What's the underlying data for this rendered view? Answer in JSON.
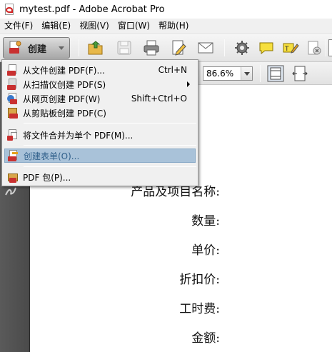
{
  "window": {
    "title": "mytest.pdf - Adobe Acrobat Pro"
  },
  "menubar": {
    "items": [
      {
        "label": "文件(F)"
      },
      {
        "label": "编辑(E)"
      },
      {
        "label": "视图(V)"
      },
      {
        "label": "窗口(W)"
      },
      {
        "label": "帮助(H)"
      }
    ]
  },
  "toolbar": {
    "create_label": "创建",
    "icons": [
      "open-folder-icon",
      "save-icon",
      "print-icon",
      "edit-document-icon",
      "email-icon",
      "settings-gear-icon",
      "comment-bubble-icon",
      "highlight-pen-icon",
      "attach-icon"
    ]
  },
  "toolbar2": {
    "zoom_value": "86.6%"
  },
  "dropdown": {
    "items": [
      {
        "label": "从文件创建 PDF(F)...",
        "shortcut": "Ctrl+N",
        "icon": "pdf-from-file-icon"
      },
      {
        "label": "从扫描仪创建 PDF(S)",
        "shortcut": "",
        "icon": "pdf-from-scanner-icon",
        "submenu": true
      },
      {
        "label": "从网页创建 PDF(W)",
        "shortcut": "Shift+Ctrl+O",
        "icon": "pdf-from-web-icon"
      },
      {
        "label": "从剪贴板创建 PDF(C)",
        "shortcut": "",
        "icon": "pdf-from-clipboard-icon"
      },
      {
        "label": "将文件合并为单个 PDF(M)...",
        "shortcut": "",
        "icon": "combine-files-icon"
      },
      {
        "label": "创建表单(O)...",
        "shortcut": "",
        "icon": "create-form-icon",
        "highlighted": true
      },
      {
        "label": "PDF 包(P)...",
        "shortcut": "",
        "icon": "pdf-portfolio-icon"
      }
    ]
  },
  "document": {
    "lines": [
      "产品及项目名称:",
      "数量:",
      "单价:",
      "折扣价:",
      "工时费:",
      "金额:"
    ]
  }
}
